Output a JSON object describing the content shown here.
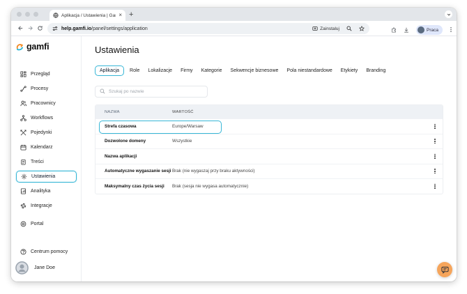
{
  "browser": {
    "tab_title": "Aplikacja / Ustawienia | Gamfi",
    "url_host": "help.gamfi.io",
    "url_path": "/panel/settings/application",
    "install_label": "Zainstaluj",
    "profile_label": "Praca"
  },
  "sidebar": {
    "logo": "gamfi",
    "items": [
      {
        "label": "Przegląd",
        "icon": "dashboard-icon"
      },
      {
        "label": "Procesy",
        "icon": "process-icon"
      },
      {
        "label": "Pracownicy",
        "icon": "users-icon"
      },
      {
        "label": "Workflows",
        "icon": "workflow-icon"
      },
      {
        "label": "Pojedynki",
        "icon": "duel-icon"
      },
      {
        "label": "Kalendarz",
        "icon": "calendar-icon"
      },
      {
        "label": "Treści",
        "icon": "content-icon"
      },
      {
        "label": "Ustawienia",
        "icon": "settings-icon",
        "active": true
      },
      {
        "label": "Analityka",
        "icon": "analytics-icon"
      },
      {
        "label": "Integracje",
        "icon": "integrations-icon"
      },
      {
        "label": "Portal",
        "icon": "portal-icon"
      },
      {
        "label": "Centrum pomocy",
        "icon": "help-icon"
      }
    ],
    "user_name": "Jane Doe"
  },
  "main": {
    "title": "Ustawienia",
    "tabs": [
      {
        "label": "Aplikacja",
        "active": true
      },
      {
        "label": "Role"
      },
      {
        "label": "Lokalizacje"
      },
      {
        "label": "Firmy"
      },
      {
        "label": "Kategorie"
      },
      {
        "label": "Sekwencje biznesowe"
      },
      {
        "label": "Pola niestandardowe"
      },
      {
        "label": "Etykiety"
      },
      {
        "label": "Branding"
      }
    ],
    "search_placeholder": "Szukaj po nazwie",
    "table": {
      "headers": [
        "NAZWA",
        "WARTOŚĆ"
      ],
      "rows": [
        {
          "name": "Strefa czasowa",
          "value": "Europe/Warsaw",
          "highlighted": true
        },
        {
          "name": "Dozwolone domeny",
          "value": "Wszystkie"
        },
        {
          "name": "Nazwa aplikacji",
          "value": ""
        },
        {
          "name": "Automatyczne wygaszanie sesji",
          "value": "Brak (nie wygaszaj przy braku aktywności)"
        },
        {
          "name": "Maksymalny czas życia sesji",
          "value": "Brak (sesja nie wygasa automatycznie)"
        }
      ]
    }
  },
  "colors": {
    "accent": "#36b6d6",
    "chat_button": "#f6a55b",
    "table_header_bg": "#eef1f5"
  }
}
